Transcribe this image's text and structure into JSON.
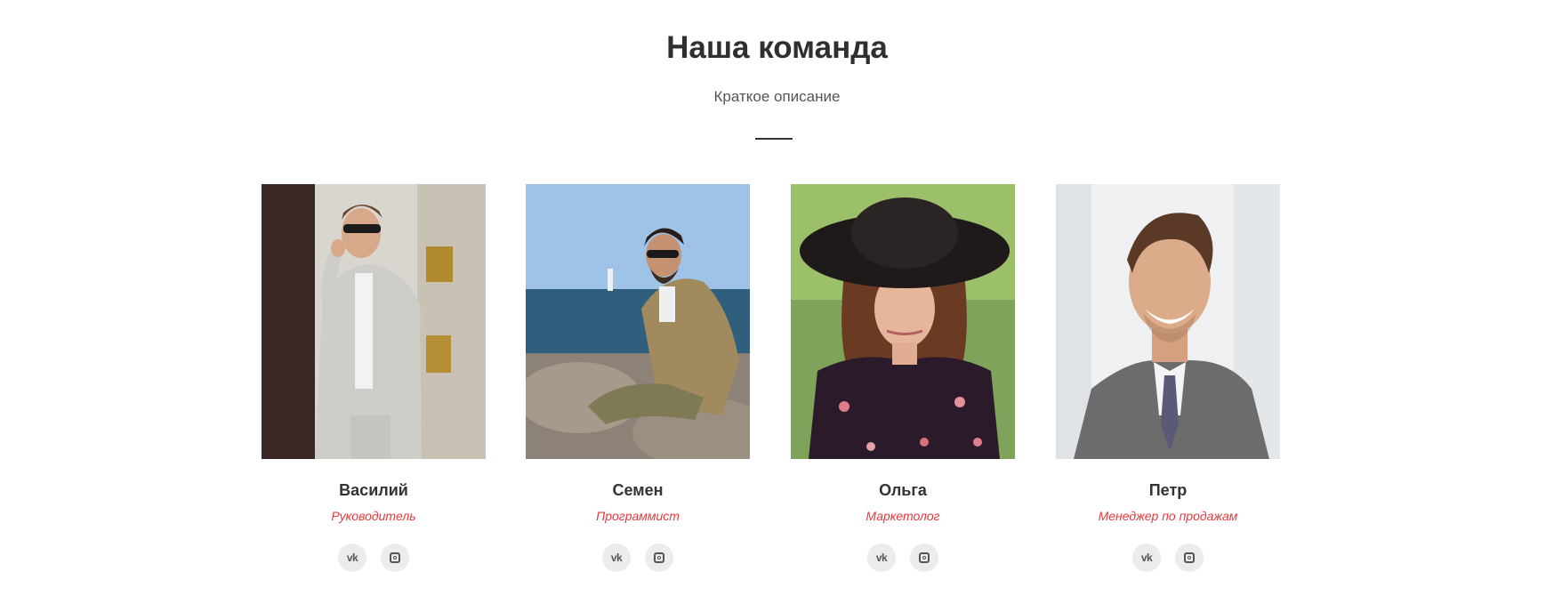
{
  "header": {
    "title": "Наша команда",
    "subtitle": "Краткое описание"
  },
  "accent_color": "#e8383d",
  "team": [
    {
      "name": "Василий",
      "role": "Руководитель",
      "socials": [
        "vk-icon",
        "instagram-icon"
      ]
    },
    {
      "name": "Семен",
      "role": "Программист",
      "socials": [
        "vk-icon",
        "instagram-icon"
      ]
    },
    {
      "name": "Ольга",
      "role": "Маркетолог",
      "socials": [
        "vk-icon",
        "instagram-icon"
      ]
    },
    {
      "name": "Петр",
      "role": "Менеджер по продажам",
      "socials": [
        "vk-icon",
        "instagram-icon"
      ]
    }
  ]
}
